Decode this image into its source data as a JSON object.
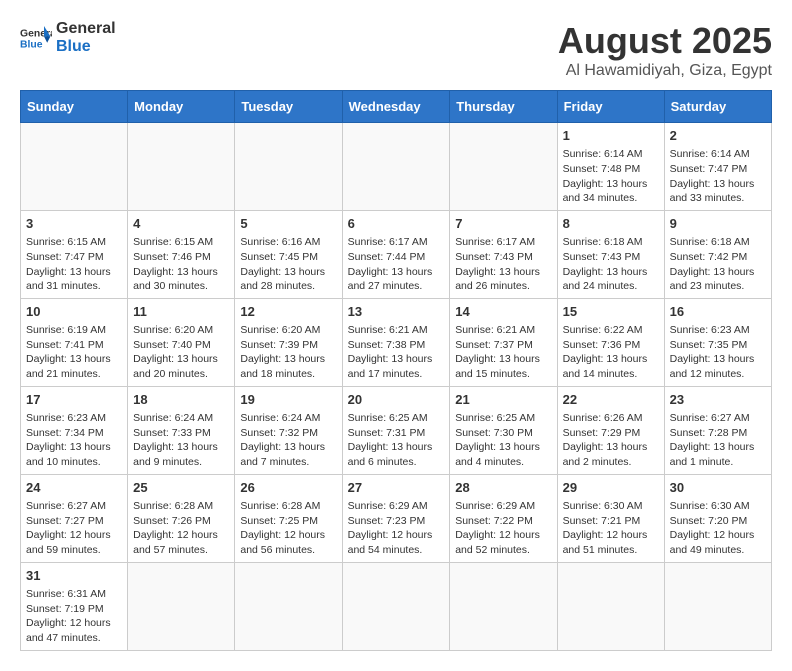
{
  "logo": {
    "line1": "General",
    "line2": "Blue"
  },
  "title": "August 2025",
  "subtitle": "Al Hawamidiyah, Giza, Egypt",
  "days_of_week": [
    "Sunday",
    "Monday",
    "Tuesday",
    "Wednesday",
    "Thursday",
    "Friday",
    "Saturday"
  ],
  "weeks": [
    [
      {
        "day": "",
        "info": ""
      },
      {
        "day": "",
        "info": ""
      },
      {
        "day": "",
        "info": ""
      },
      {
        "day": "",
        "info": ""
      },
      {
        "day": "",
        "info": ""
      },
      {
        "day": "1",
        "info": "Sunrise: 6:14 AM\nSunset: 7:48 PM\nDaylight: 13 hours and 34 minutes."
      },
      {
        "day": "2",
        "info": "Sunrise: 6:14 AM\nSunset: 7:47 PM\nDaylight: 13 hours and 33 minutes."
      }
    ],
    [
      {
        "day": "3",
        "info": "Sunrise: 6:15 AM\nSunset: 7:47 PM\nDaylight: 13 hours and 31 minutes."
      },
      {
        "day": "4",
        "info": "Sunrise: 6:15 AM\nSunset: 7:46 PM\nDaylight: 13 hours and 30 minutes."
      },
      {
        "day": "5",
        "info": "Sunrise: 6:16 AM\nSunset: 7:45 PM\nDaylight: 13 hours and 28 minutes."
      },
      {
        "day": "6",
        "info": "Sunrise: 6:17 AM\nSunset: 7:44 PM\nDaylight: 13 hours and 27 minutes."
      },
      {
        "day": "7",
        "info": "Sunrise: 6:17 AM\nSunset: 7:43 PM\nDaylight: 13 hours and 26 minutes."
      },
      {
        "day": "8",
        "info": "Sunrise: 6:18 AM\nSunset: 7:43 PM\nDaylight: 13 hours and 24 minutes."
      },
      {
        "day": "9",
        "info": "Sunrise: 6:18 AM\nSunset: 7:42 PM\nDaylight: 13 hours and 23 minutes."
      }
    ],
    [
      {
        "day": "10",
        "info": "Sunrise: 6:19 AM\nSunset: 7:41 PM\nDaylight: 13 hours and 21 minutes."
      },
      {
        "day": "11",
        "info": "Sunrise: 6:20 AM\nSunset: 7:40 PM\nDaylight: 13 hours and 20 minutes."
      },
      {
        "day": "12",
        "info": "Sunrise: 6:20 AM\nSunset: 7:39 PM\nDaylight: 13 hours and 18 minutes."
      },
      {
        "day": "13",
        "info": "Sunrise: 6:21 AM\nSunset: 7:38 PM\nDaylight: 13 hours and 17 minutes."
      },
      {
        "day": "14",
        "info": "Sunrise: 6:21 AM\nSunset: 7:37 PM\nDaylight: 13 hours and 15 minutes."
      },
      {
        "day": "15",
        "info": "Sunrise: 6:22 AM\nSunset: 7:36 PM\nDaylight: 13 hours and 14 minutes."
      },
      {
        "day": "16",
        "info": "Sunrise: 6:23 AM\nSunset: 7:35 PM\nDaylight: 13 hours and 12 minutes."
      }
    ],
    [
      {
        "day": "17",
        "info": "Sunrise: 6:23 AM\nSunset: 7:34 PM\nDaylight: 13 hours and 10 minutes."
      },
      {
        "day": "18",
        "info": "Sunrise: 6:24 AM\nSunset: 7:33 PM\nDaylight: 13 hours and 9 minutes."
      },
      {
        "day": "19",
        "info": "Sunrise: 6:24 AM\nSunset: 7:32 PM\nDaylight: 13 hours and 7 minutes."
      },
      {
        "day": "20",
        "info": "Sunrise: 6:25 AM\nSunset: 7:31 PM\nDaylight: 13 hours and 6 minutes."
      },
      {
        "day": "21",
        "info": "Sunrise: 6:25 AM\nSunset: 7:30 PM\nDaylight: 13 hours and 4 minutes."
      },
      {
        "day": "22",
        "info": "Sunrise: 6:26 AM\nSunset: 7:29 PM\nDaylight: 13 hours and 2 minutes."
      },
      {
        "day": "23",
        "info": "Sunrise: 6:27 AM\nSunset: 7:28 PM\nDaylight: 13 hours and 1 minute."
      }
    ],
    [
      {
        "day": "24",
        "info": "Sunrise: 6:27 AM\nSunset: 7:27 PM\nDaylight: 12 hours and 59 minutes."
      },
      {
        "day": "25",
        "info": "Sunrise: 6:28 AM\nSunset: 7:26 PM\nDaylight: 12 hours and 57 minutes."
      },
      {
        "day": "26",
        "info": "Sunrise: 6:28 AM\nSunset: 7:25 PM\nDaylight: 12 hours and 56 minutes."
      },
      {
        "day": "27",
        "info": "Sunrise: 6:29 AM\nSunset: 7:23 PM\nDaylight: 12 hours and 54 minutes."
      },
      {
        "day": "28",
        "info": "Sunrise: 6:29 AM\nSunset: 7:22 PM\nDaylight: 12 hours and 52 minutes."
      },
      {
        "day": "29",
        "info": "Sunrise: 6:30 AM\nSunset: 7:21 PM\nDaylight: 12 hours and 51 minutes."
      },
      {
        "day": "30",
        "info": "Sunrise: 6:30 AM\nSunset: 7:20 PM\nDaylight: 12 hours and 49 minutes."
      }
    ],
    [
      {
        "day": "31",
        "info": "Sunrise: 6:31 AM\nSunset: 7:19 PM\nDaylight: 12 hours and 47 minutes."
      },
      {
        "day": "",
        "info": ""
      },
      {
        "day": "",
        "info": ""
      },
      {
        "day": "",
        "info": ""
      },
      {
        "day": "",
        "info": ""
      },
      {
        "day": "",
        "info": ""
      },
      {
        "day": "",
        "info": ""
      }
    ]
  ]
}
